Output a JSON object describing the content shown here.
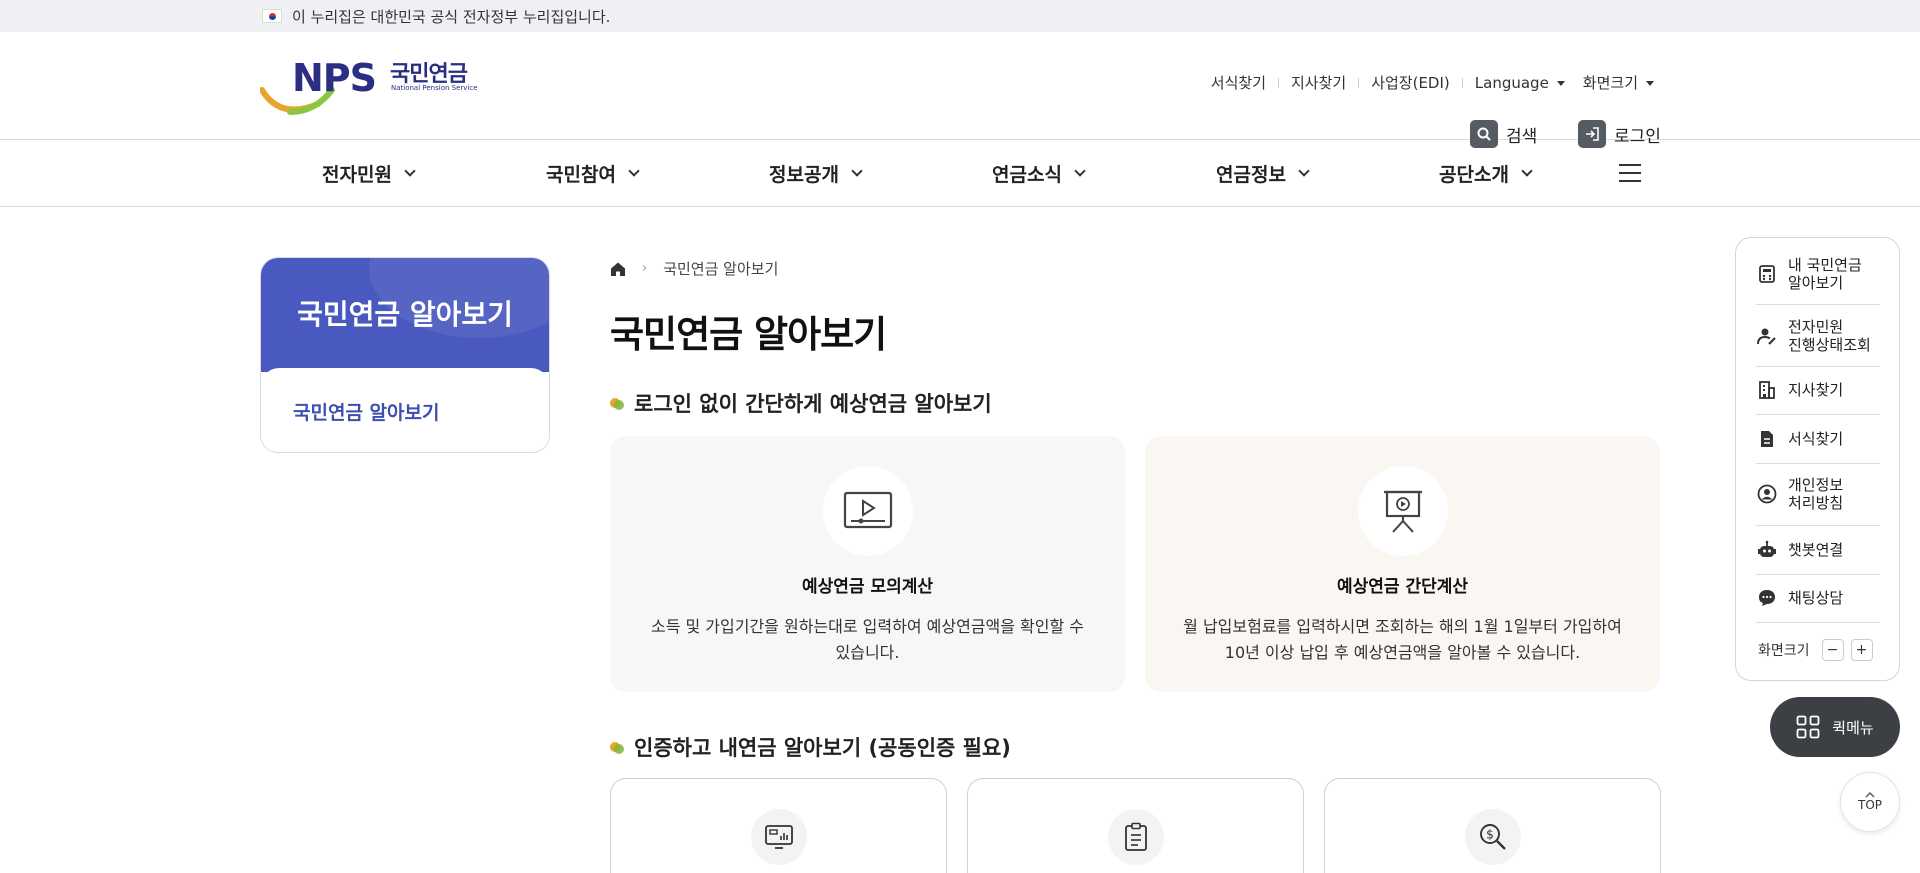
{
  "gov_banner": {
    "text": "이 누리집은 대한민국 공식 전자정부 누리집입니다."
  },
  "logo": {
    "mark": "NPS",
    "korean": "국민연금",
    "english": "National Pension Service"
  },
  "util_links": [
    "서식찾기",
    "지사찾기",
    "사업장(EDI)",
    "Language",
    "화면크기"
  ],
  "header_buttons": {
    "search": "검색",
    "login": "로그인"
  },
  "gnb": [
    "전자민원",
    "국민참여",
    "정보공개",
    "연금소식",
    "연금정보",
    "공단소개"
  ],
  "sidebar": {
    "title": "국민연금 알아보기",
    "active_item": "국민연금 알아보기"
  },
  "breadcrumb": {
    "current": "국민연금 알아보기"
  },
  "page_title": "국민연금 알아보기",
  "section1": {
    "heading": "로그인 없이 간단하게 예상연금 알아보기",
    "cards": [
      {
        "title": "예상연금 모의계산",
        "desc_line1": "소득 및 가입기간을 원하는대로 입력하여 예상연금액을 확인할 수",
        "desc_line2": "있습니다."
      },
      {
        "title": "예상연금 간단계산",
        "desc_line1": "월 납입보험료를 입력하시면 조회하는 해의 1월 1일부터 가입하여",
        "desc_line2": "10년 이상 납입 후 예상연금액을 알아볼 수 있습니다."
      }
    ]
  },
  "section2": {
    "heading": "인증하고 내연금 알아보기 (공동인증 필요)"
  },
  "quick_menu": {
    "items": [
      {
        "line1": "내 국민연금",
        "line2": "알아보기"
      },
      {
        "line1": "전자민원",
        "line2": "진행상태조회"
      },
      {
        "line1": "지사찾기",
        "line2": ""
      },
      {
        "line1": "서식찾기",
        "line2": ""
      },
      {
        "line1": "개인정보",
        "line2": "처리방침"
      },
      {
        "line1": "챗봇연결",
        "line2": ""
      },
      {
        "line1": "채팅상담",
        "line2": ""
      }
    ],
    "zoom_label": "화면크기",
    "zoom_minus": "−",
    "zoom_plus": "+",
    "button": "퀵메뉴",
    "top": "TOP"
  },
  "colors": {
    "brand": "#2b2e82",
    "side_header": "#4a59bf",
    "card1_bg": "#f7f7f8",
    "card2_bg": "#faf7f3"
  }
}
